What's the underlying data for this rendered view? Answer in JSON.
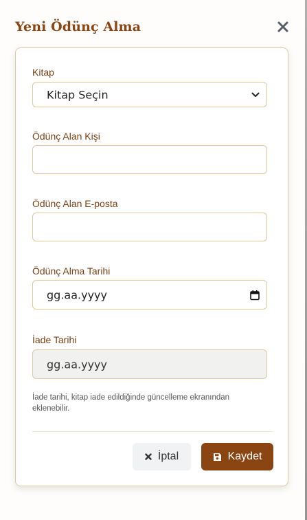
{
  "modal": {
    "title": "Yeni Ödünç Alma",
    "close_icon": "close-icon"
  },
  "form": {
    "book": {
      "label": "Kitap",
      "value": "Kitap Seçin"
    },
    "borrower_name": {
      "label": "Ödünç Alan Kişi",
      "value": ""
    },
    "borrower_email": {
      "label": "Ödünç Alan E-posta",
      "value": ""
    },
    "borrow_date": {
      "label": "Ödünç Alma Tarihi",
      "value": "gg.aa.yyyy",
      "icon": "calendar-icon"
    },
    "return_date": {
      "label": "İade Tarihi",
      "value": "gg.aa.yyyy",
      "disabled": true
    },
    "help_text": "İade tarihi, kitap iade edildiğinde güncelleme ekranından eklenebilir."
  },
  "actions": {
    "cancel_label": "İptal",
    "save_label": "Kaydet"
  },
  "colors": {
    "accent": "#8b4513",
    "border": "#e0c79c",
    "disabled_bg": "#f1f1f0"
  }
}
